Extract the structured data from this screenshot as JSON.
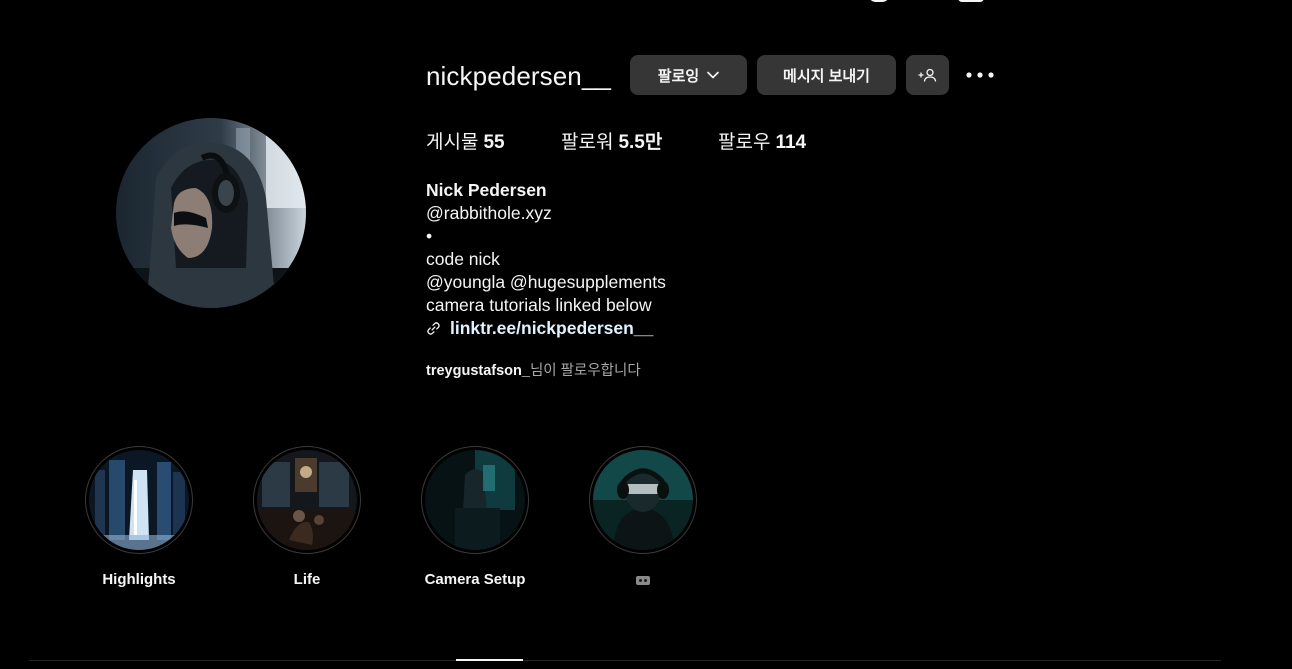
{
  "profile": {
    "username": "nickpedersen__",
    "following_button_label": "팔로잉",
    "message_button_label": "메시지 보내기",
    "suggest_icon": "person-plus-icon",
    "more_icon": "more-horizontal-icon"
  },
  "stats": {
    "posts_label": "게시물",
    "posts_value": "55",
    "followers_label": "팔로워",
    "followers_value": "5.5만",
    "following_label": "팔로우",
    "following_value": "114"
  },
  "bio": {
    "full_name": "Nick Pedersen",
    "lines": [
      "@rabbithole.xyz",
      "•",
      "code nick",
      "@youngla @hugesupplements",
      "camera tutorials linked below"
    ],
    "link": "linktr.ee/nickpedersen__",
    "link_icon": "link-icon"
  },
  "followed_by": {
    "user": "treygustafson_",
    "suffix": "님이 팔로우합니다"
  },
  "highlights": [
    {
      "label": "Highlights"
    },
    {
      "label": "Life"
    },
    {
      "label": "Camera Setup"
    },
    {
      "label": "",
      "icon": "cassette-tape-icon"
    }
  ],
  "colors": {
    "background": "#000000",
    "button_bg": "#363636",
    "text_primary": "#f5f5f5",
    "text_secondary": "#a8a8a8",
    "link": "#e0f1ff"
  }
}
